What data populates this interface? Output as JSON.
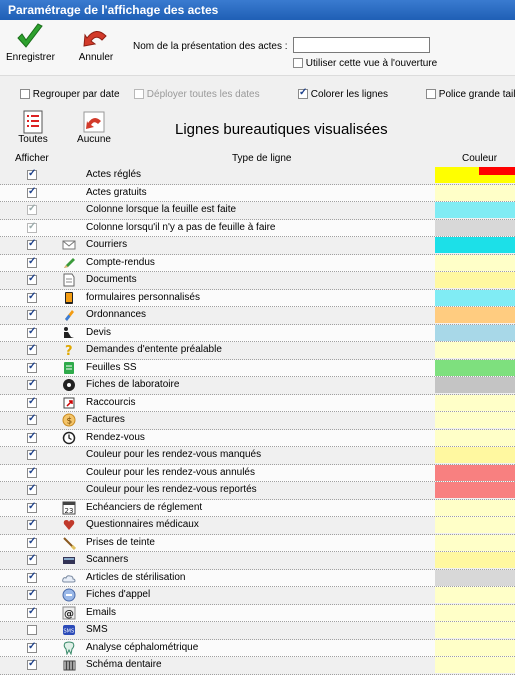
{
  "window": {
    "title": "Paramétrage de l'affichage des actes"
  },
  "toolbar": {
    "save_label": "Enregistrer",
    "cancel_label": "Annuler",
    "presentation_label": "Nom de la présentation des actes :",
    "presentation_value": "",
    "open_view_label": "Utiliser cette vue à l'ouverture"
  },
  "options": {
    "group_by_date": "Regrouper par date",
    "expand_dates": "Déployer toutes les dates",
    "color_rows": "Colorer les lignes",
    "large_font": "Police grande taille"
  },
  "list": {
    "all_label": "Toutes",
    "none_label": "Aucune",
    "title": "Lignes bureautiques visualisées",
    "col_show": "Afficher",
    "col_type": "Type de ligne",
    "col_color": "Couleur"
  },
  "rows": [
    {
      "label": "Actes réglés",
      "checked": true,
      "disabled": false,
      "icon": "",
      "color": "#ffff00",
      "color2": "#ff0000"
    },
    {
      "label": "Actes gratuits",
      "checked": true,
      "disabled": false,
      "icon": "",
      "color": "#ffffc8"
    },
    {
      "label": "Colonne lorsque la feuille est faite",
      "checked": true,
      "disabled": true,
      "icon": "",
      "color": "#80ecf4"
    },
    {
      "label": "Colonne lorsqu'il n'y a pas de feuille à faire",
      "checked": true,
      "disabled": true,
      "icon": "",
      "color": "#d8d8d8"
    },
    {
      "label": "Courriers",
      "checked": true,
      "disabled": false,
      "icon": "envelope-icon",
      "color": "#1ce0e8"
    },
    {
      "label": "Compte-rendus",
      "checked": true,
      "disabled": false,
      "icon": "pencil-icon",
      "color": "#ffffc8"
    },
    {
      "label": "Documents",
      "checked": true,
      "disabled": false,
      "icon": "document-icon",
      "color": "#fff8a0"
    },
    {
      "label": "formulaires personnalisés",
      "checked": true,
      "disabled": false,
      "icon": "form-icon",
      "color": "#80ecf4"
    },
    {
      "label": "Ordonnances",
      "checked": true,
      "disabled": false,
      "icon": "pill-icon",
      "color": "#ffcc80"
    },
    {
      "label": "Devis",
      "checked": true,
      "disabled": false,
      "icon": "quote-icon",
      "color": "#a8d8e8"
    },
    {
      "label": "Demandes d'entente préalable",
      "checked": true,
      "disabled": false,
      "icon": "question-icon",
      "color": "#ffffc8"
    },
    {
      "label": "Feuilles SS",
      "checked": true,
      "disabled": false,
      "icon": "sheet-icon",
      "color": "#7ee07e"
    },
    {
      "label": "Fiches de laboratoire",
      "checked": true,
      "disabled": false,
      "icon": "lab-icon",
      "color": "#c4c4c4"
    },
    {
      "label": "Raccourcis",
      "checked": true,
      "disabled": false,
      "icon": "shortcut-icon",
      "color": "#ffffc8"
    },
    {
      "label": "Factures",
      "checked": true,
      "disabled": false,
      "icon": "invoice-icon",
      "color": "#ffffc8"
    },
    {
      "label": "Rendez-vous",
      "checked": true,
      "disabled": false,
      "icon": "clock-icon",
      "color": "#ffffc8"
    },
    {
      "label": "Couleur pour les rendez-vous manqués",
      "checked": true,
      "disabled": false,
      "icon": "",
      "color": "#fff8a0"
    },
    {
      "label": "Couleur pour les rendez-vous annulés",
      "checked": true,
      "disabled": false,
      "icon": "",
      "color": "#f88080"
    },
    {
      "label": "Couleur pour les rendez-vous reportés",
      "checked": true,
      "disabled": false,
      "icon": "",
      "color": "#f88080"
    },
    {
      "label": "Echéanciers de réglement",
      "checked": true,
      "disabled": false,
      "icon": "calendar-icon",
      "color": "#ffffc8"
    },
    {
      "label": "Questionnaires médicaux",
      "checked": true,
      "disabled": false,
      "icon": "heart-icon",
      "color": "#ffffc8"
    },
    {
      "label": "Prises de teinte",
      "checked": true,
      "disabled": false,
      "icon": "brush-icon",
      "color": "#ffffc8"
    },
    {
      "label": "Scanners",
      "checked": true,
      "disabled": false,
      "icon": "scanner-icon",
      "color": "#fff8a0"
    },
    {
      "label": "Articles de stérilisation",
      "checked": true,
      "disabled": false,
      "icon": "cloud-icon",
      "color": "#d8d8d8"
    },
    {
      "label": "Fiches d'appel",
      "checked": true,
      "disabled": false,
      "icon": "phone-icon",
      "color": "#ffffc8"
    },
    {
      "label": "Emails",
      "checked": true,
      "disabled": false,
      "icon": "email-icon",
      "color": "#ffffc8"
    },
    {
      "label": "SMS",
      "checked": false,
      "disabled": false,
      "icon": "sms-icon",
      "color": "#ffffc8"
    },
    {
      "label": "Analyse céphalométrique",
      "checked": true,
      "disabled": false,
      "icon": "tooth-icon",
      "color": "#ffffc8"
    },
    {
      "label": "Schéma dentaire",
      "checked": true,
      "disabled": false,
      "icon": "teeth-icon",
      "color": "#ffffc8"
    }
  ]
}
